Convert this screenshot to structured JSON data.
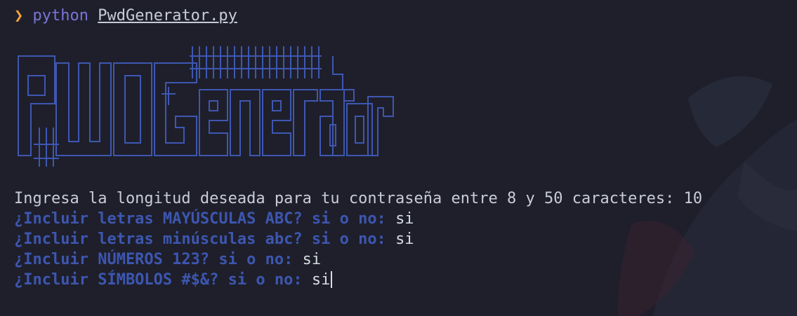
{
  "prompt": {
    "symbol": "❯",
    "command": "python",
    "file": "PwdGenerator.py"
  },
  "banner": {
    "text": "PwdGenerator",
    "color": "#3e57b2"
  },
  "output": {
    "length_prompt": "Ingresa la longitud deseada para tu contraseña entre 8 y 50 caracteres: 10",
    "questions": [
      {
        "label": "¿Incluir letras MAYÚSCULAS ABC? si o no: ",
        "answer": "si"
      },
      {
        "label": "¿Incluir letras minúsculas abc? si o no: ",
        "answer": "si"
      },
      {
        "label": "¿Incluir NÚMEROS 123? si o no: ",
        "answer": "si"
      },
      {
        "label": "¿Incluir SÍMBOLOS #$&? si o no: ",
        "answer": "si"
      }
    ]
  },
  "colors": {
    "background": "#1e1f2b",
    "prompt_symbol": "#f2a33a",
    "command": "#7b74d9",
    "question": "#3d56b0",
    "text": "#c9ccd6"
  }
}
